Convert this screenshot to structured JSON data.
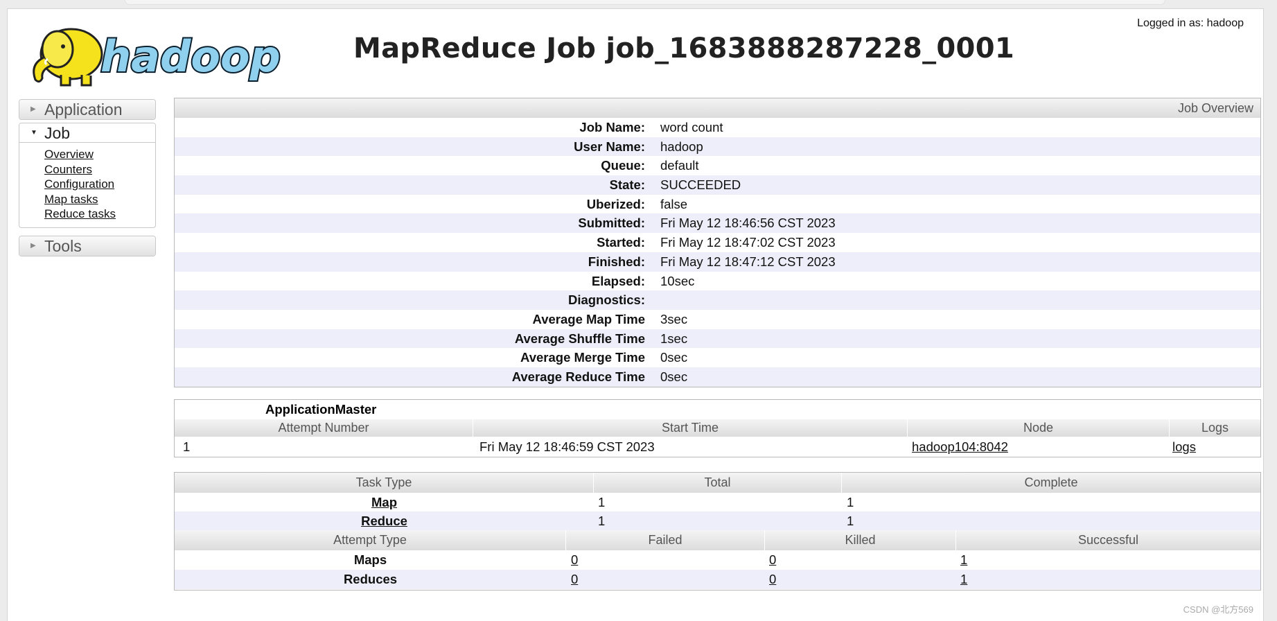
{
  "header": {
    "logged_in": "Logged in as: hadoop",
    "title": "MapReduce Job job_1683888287228_0001",
    "logo_text": "hadoop"
  },
  "sidebar": {
    "sections": [
      {
        "label": "Application",
        "expanded": false
      },
      {
        "label": "Job",
        "expanded": true,
        "items": [
          "Overview",
          "Counters",
          "Configuration",
          "Map tasks",
          "Reduce tasks"
        ]
      },
      {
        "label": "Tools",
        "expanded": false
      }
    ]
  },
  "overview": {
    "caption": "Job Overview",
    "rows": [
      {
        "label": "Job Name:",
        "value": "word count"
      },
      {
        "label": "User Name:",
        "value": "hadoop"
      },
      {
        "label": "Queue:",
        "value": "default"
      },
      {
        "label": "State:",
        "value": "SUCCEEDED"
      },
      {
        "label": "Uberized:",
        "value": "false"
      },
      {
        "label": "Submitted:",
        "value": "Fri May 12 18:46:56 CST 2023"
      },
      {
        "label": "Started:",
        "value": "Fri May 12 18:47:02 CST 2023"
      },
      {
        "label": "Finished:",
        "value": "Fri May 12 18:47:12 CST 2023"
      },
      {
        "label": "Elapsed:",
        "value": "10sec"
      },
      {
        "label": "Diagnostics:",
        "value": ""
      },
      {
        "label": "Average Map Time",
        "value": "3sec"
      },
      {
        "label": "Average Shuffle Time",
        "value": "1sec"
      },
      {
        "label": "Average Merge Time",
        "value": "0sec"
      },
      {
        "label": "Average Reduce Time",
        "value": "0sec"
      }
    ]
  },
  "appmaster": {
    "caption": "ApplicationMaster",
    "columns": [
      "Attempt Number",
      "Start Time",
      "Node",
      "Logs"
    ],
    "rows": [
      {
        "attempt": "1",
        "start": "Fri May 12 18:46:59 CST 2023",
        "node": "hadoop104:8042",
        "logs": "logs"
      }
    ]
  },
  "tasks": {
    "columns": [
      "Task Type",
      "Total",
      "Complete"
    ],
    "rows": [
      {
        "type": "Map",
        "total": "1",
        "complete": "1"
      },
      {
        "type": "Reduce",
        "total": "1",
        "complete": "1"
      }
    ],
    "attempt_columns": [
      "Attempt Type",
      "Failed",
      "Killed",
      "Successful"
    ],
    "attempt_rows": [
      {
        "type": "Maps",
        "failed": "0",
        "killed": "0",
        "successful": "1"
      },
      {
        "type": "Reduces",
        "failed": "0",
        "killed": "0",
        "successful": "1"
      }
    ]
  },
  "watermark": "CSDN @北方569",
  "colors": {
    "alt_row": "#eeeefa",
    "header_gray": "#dcdcdc",
    "logo_yellow": "#f5e21c",
    "logo_blue": "#8fd0ee"
  }
}
